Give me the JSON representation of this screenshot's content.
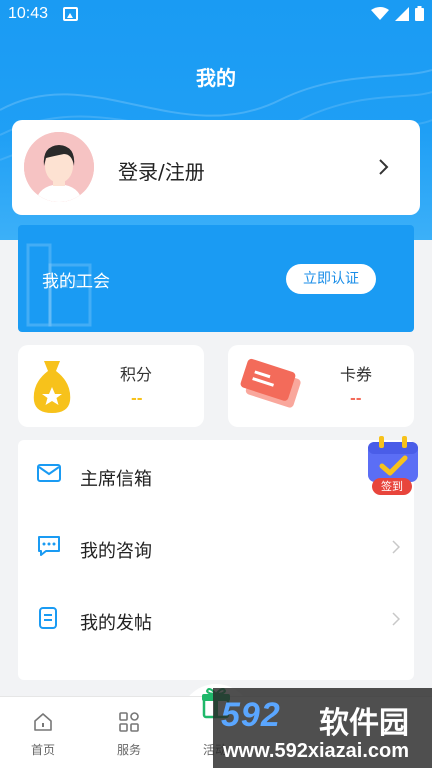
{
  "status_bar": {
    "time": "10:43"
  },
  "header": {
    "title": "我的"
  },
  "profile": {
    "login_label": "登录/注册"
  },
  "union": {
    "label": "我的工会",
    "verify_button": "立即认证"
  },
  "points": {
    "title": "积分",
    "value": "--"
  },
  "coupons": {
    "title": "卡券",
    "value": "--"
  },
  "menu": {
    "items": [
      {
        "label": "主席信箱",
        "icon": "mail-icon"
      },
      {
        "label": "我的咨询",
        "icon": "chat-icon"
      },
      {
        "label": "我的发帖",
        "icon": "document-icon"
      }
    ]
  },
  "signin": {
    "label": "签到"
  },
  "tabbar": {
    "tabs": [
      {
        "label": "首页",
        "icon": "home-icon"
      },
      {
        "label": "服务",
        "icon": "grid-icon"
      },
      {
        "label": "活动",
        "icon": "gift-icon"
      }
    ]
  },
  "watermark": {
    "logo": "592",
    "brand": "软件园",
    "url": "www.592xiazai.com"
  },
  "colors": {
    "primary": "#1a9bf3",
    "accent_red": "#e8453c",
    "coupon_red": "#f36b5a",
    "points_gold": "#f7c21b"
  }
}
